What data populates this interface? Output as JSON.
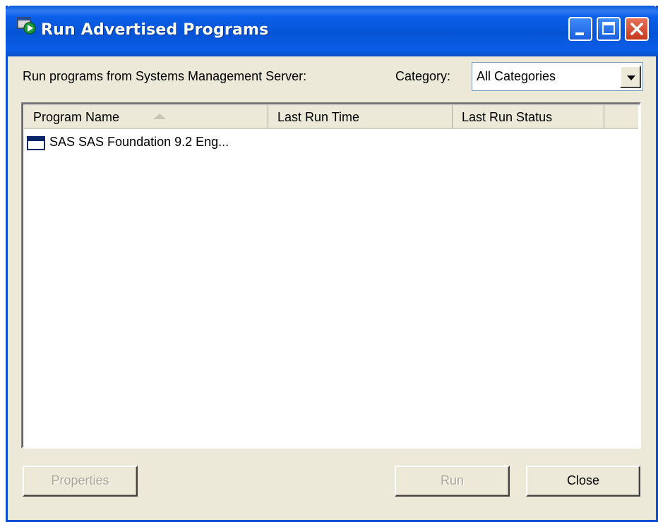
{
  "window": {
    "title": "Run Advertised Programs"
  },
  "top": {
    "source_label": "Run programs from Systems Management Server:",
    "category_label": "Category:",
    "category_value": "All Categories"
  },
  "list": {
    "columns": [
      "Program Name",
      "Last Run Time",
      "Last Run Status",
      ""
    ],
    "sorted_column": "Program Name",
    "rows": [
      {
        "program_name": "SAS SAS Foundation 9.2 Eng...",
        "last_run_time": "",
        "last_run_status": ""
      }
    ]
  },
  "buttons": {
    "properties": "Properties",
    "run": "Run",
    "close": "Close"
  },
  "colors": {
    "titlebar": "#0554d6",
    "window_bg": "#ece9d8",
    "close_button": "#c5381c"
  }
}
